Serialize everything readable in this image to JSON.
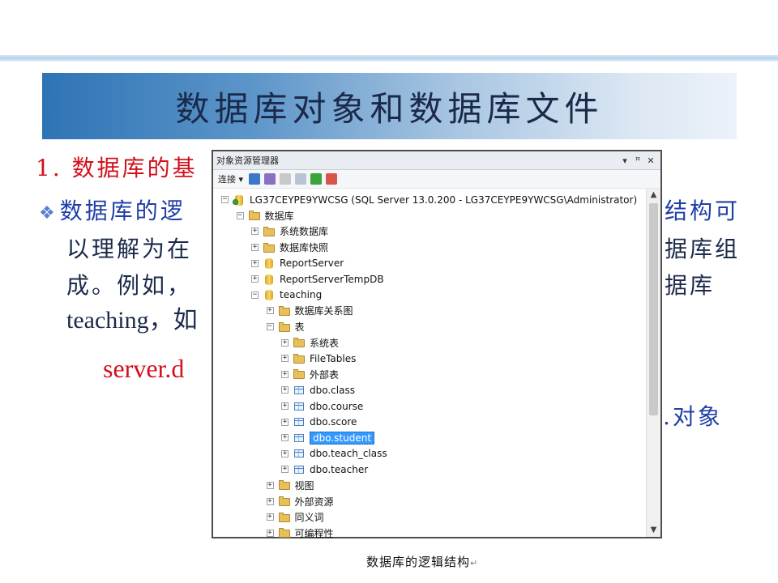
{
  "slide": {
    "title": "数据库对象和数据库文件",
    "heading": "1. 数据库的基",
    "bullet_symbol": "❖",
    "line1": "数据库的逻",
    "line1_tail": "结构可",
    "line2": "以理解为在",
    "line2_tail": "据库组",
    "line3": "成。例如，",
    "line3_tail": "据库",
    "line4": "teaching，如",
    "code_line": "server.d",
    "line6_tail": ".对象",
    "caption": "数据库的逻辑结构",
    "caption_mark": "↵"
  },
  "panel": {
    "title": "对象资源管理器",
    "pin": "ꟷ ꟸ ✕",
    "toolbar": {
      "connect_label": "连接 ▾"
    },
    "tree": [
      {
        "label": "LG37CEYPE9YWCSG (SQL Server 13.0.200 - LG37CEYPE9YWCSG\\Administrator)",
        "exp": "⊟",
        "icon": "server",
        "indent": 0
      },
      {
        "label": "数据库",
        "exp": "⊟",
        "icon": "folder",
        "indent": 1
      },
      {
        "label": "系统数据库",
        "exp": "⊞",
        "icon": "folder",
        "indent": 2
      },
      {
        "label": "数据库快照",
        "exp": "⊞",
        "icon": "folder",
        "indent": 2
      },
      {
        "label": "ReportServer",
        "exp": "⊞",
        "icon": "db",
        "indent": 2
      },
      {
        "label": "ReportServerTempDB",
        "exp": "⊞",
        "icon": "db",
        "indent": 2
      },
      {
        "label": "teaching",
        "exp": "⊟",
        "icon": "db",
        "indent": 2
      },
      {
        "label": "数据库关系图",
        "exp": "⊞",
        "icon": "folder",
        "indent": 3
      },
      {
        "label": "表",
        "exp": "⊟",
        "icon": "folder",
        "indent": 3
      },
      {
        "label": "系统表",
        "exp": "⊞",
        "icon": "folder",
        "indent": 4
      },
      {
        "label": "FileTables",
        "exp": "⊞",
        "icon": "folder",
        "indent": 4
      },
      {
        "label": "外部表",
        "exp": "⊞",
        "icon": "folder",
        "indent": 4
      },
      {
        "label": "dbo.class",
        "exp": "⊞",
        "icon": "table",
        "indent": 4
      },
      {
        "label": "dbo.course",
        "exp": "⊞",
        "icon": "table",
        "indent": 4
      },
      {
        "label": "dbo.score",
        "exp": "⊞",
        "icon": "table",
        "indent": 4
      },
      {
        "label": "dbo.student",
        "exp": "⊞",
        "icon": "table",
        "indent": 4,
        "selected": true
      },
      {
        "label": "dbo.teach_class",
        "exp": "⊞",
        "icon": "table",
        "indent": 4
      },
      {
        "label": "dbo.teacher",
        "exp": "⊞",
        "icon": "table",
        "indent": 4
      },
      {
        "label": "视图",
        "exp": "⊞",
        "icon": "folder",
        "indent": 3
      },
      {
        "label": "外部资源",
        "exp": "⊞",
        "icon": "folder",
        "indent": 3
      },
      {
        "label": "同义词",
        "exp": "⊞",
        "icon": "folder",
        "indent": 3
      },
      {
        "label": "可编程性",
        "exp": "⊞",
        "icon": "folder",
        "indent": 3
      }
    ]
  }
}
